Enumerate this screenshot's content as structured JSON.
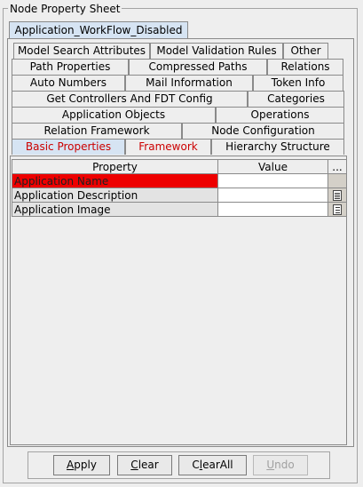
{
  "panel": {
    "title": "Node Property Sheet"
  },
  "outer_tab": {
    "label": "Application_WorkFlow_Disabled"
  },
  "tab_rows": [
    [
      "Model Search Attributes",
      "Model Validation Rules",
      "Other"
    ],
    [
      "Path Properties",
      "Compressed Paths",
      "Relations"
    ],
    [
      "Auto Numbers",
      "Mail Information",
      "Token Info"
    ],
    [
      "Get Controllers And FDT Config",
      "Categories"
    ],
    [
      "Application Objects",
      "Operations"
    ],
    [
      "Relation Framework",
      "Node Configuration"
    ],
    [
      "Basic Properties",
      "Framework",
      "Hierarchy Structure"
    ]
  ],
  "selected_tab": "Basic Properties",
  "table": {
    "headers": {
      "property": "Property",
      "value": "Value",
      "more": "..."
    },
    "rows": [
      {
        "property": "Application Name",
        "value": "",
        "button": ""
      },
      {
        "property": "Application Description",
        "value": "",
        "button": "doc-icon"
      },
      {
        "property": "Application Image",
        "value": "",
        "button": "list-icon"
      }
    ]
  },
  "buttons": {
    "apply": {
      "label": "Apply",
      "mnemonic": "A"
    },
    "clear": {
      "label": "Clear",
      "mnemonic": "C"
    },
    "clearall": {
      "label": "ClearAll",
      "mnemonic": "l"
    },
    "undo": {
      "label": "Undo",
      "mnemonic": "U",
      "enabled": false
    }
  },
  "colors": {
    "selected_row": "#ee0000",
    "selected_tab_bg": "#d6e4f3",
    "tab_highlight_text": "#cc0000"
  }
}
